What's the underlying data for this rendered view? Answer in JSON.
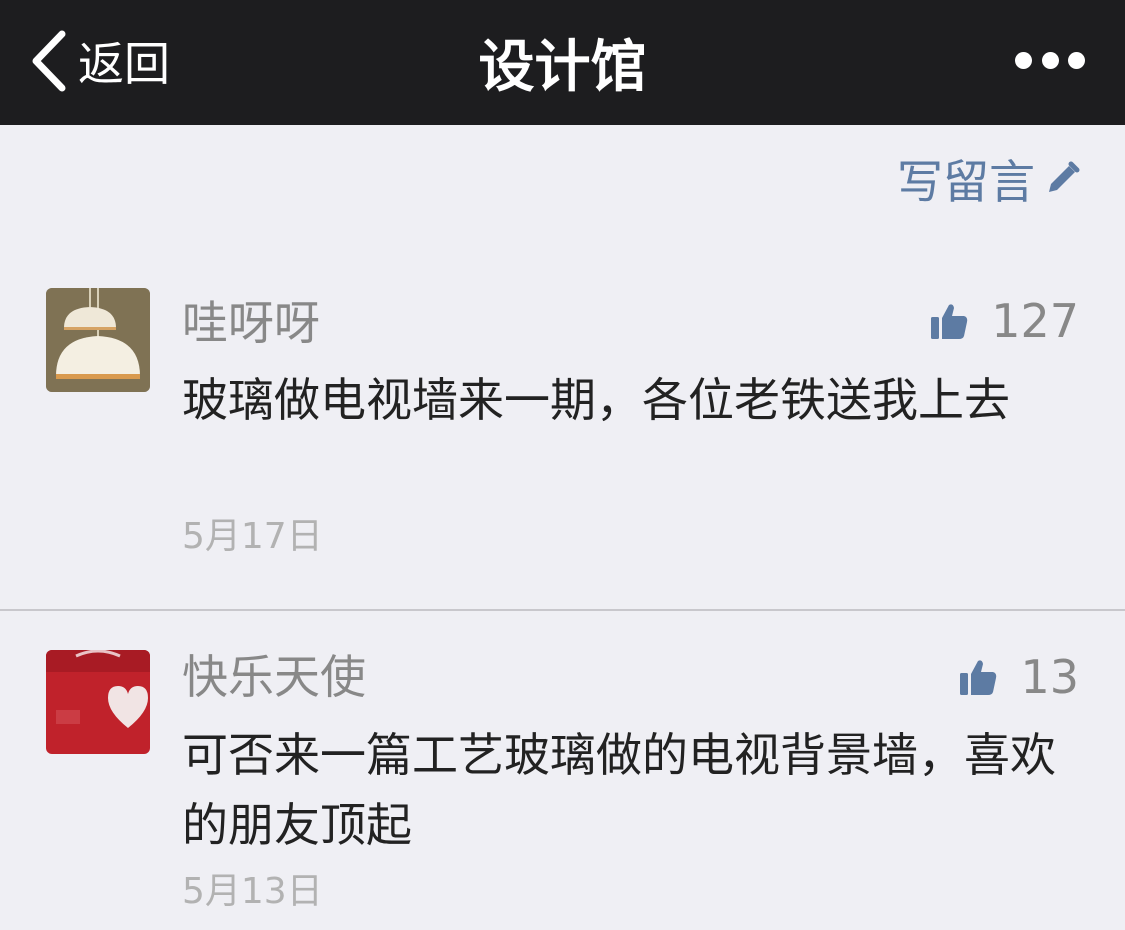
{
  "navbar": {
    "back_label": "返回",
    "title": "设计馆",
    "more_icon": "more-dots-icon"
  },
  "toolbar": {
    "write_label": "写留言",
    "write_icon": "pencil-icon"
  },
  "comments": [
    {
      "nickname": "哇呀呀",
      "likes": "127",
      "text": "玻璃做电视墙来一期，各位老铁送我上去",
      "date": "5月17日"
    },
    {
      "nickname": "快乐天使",
      "likes": "13",
      "text": "可否来一篇工艺玻璃做的电视背景墙，喜欢的朋友顶起",
      "date": "5月13日"
    }
  ],
  "colors": {
    "navbar_bg": "#1d1d1f",
    "page_bg": "#efeff4",
    "link_blue": "#5d7ba3",
    "nickname_gray": "#888888",
    "date_gray": "#b2b2b2"
  }
}
